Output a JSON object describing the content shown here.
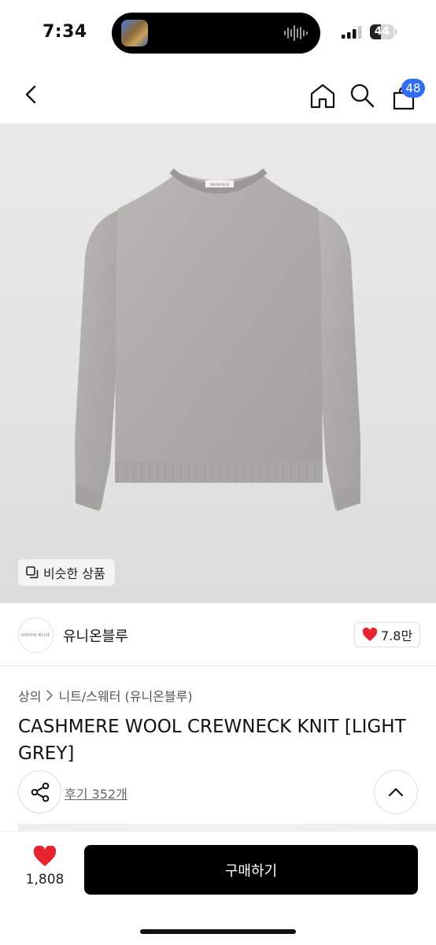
{
  "status_bar": {
    "time": "7:34",
    "battery": "44",
    "battery_level": 0.44
  },
  "header": {
    "back_icon": "chevron-left-icon",
    "home_icon": "home-icon",
    "search_icon": "search-icon",
    "cart_icon": "shopping-bag-icon",
    "cart_count": "48",
    "accent_color": "#2f6df6"
  },
  "product_image": {
    "similar_button_label": "비슷한 상품",
    "garment_tag": "UNION BLUE"
  },
  "brand": {
    "logo_text": "UNION BLUE",
    "name": "유니온블루",
    "like_count": "7.8만"
  },
  "breadcrumb": {
    "category": "상의",
    "subcategory": "니트/스웨터 (유니온블루)"
  },
  "product": {
    "title": "CASHMERE WOOL CREWNECK KNIT [LIGHT GREY]",
    "reviews_label": "후기 352개"
  },
  "bottom_bar": {
    "wish_count": "1,808",
    "buy_label": "구매하기",
    "heart_color": "#e8232d"
  }
}
